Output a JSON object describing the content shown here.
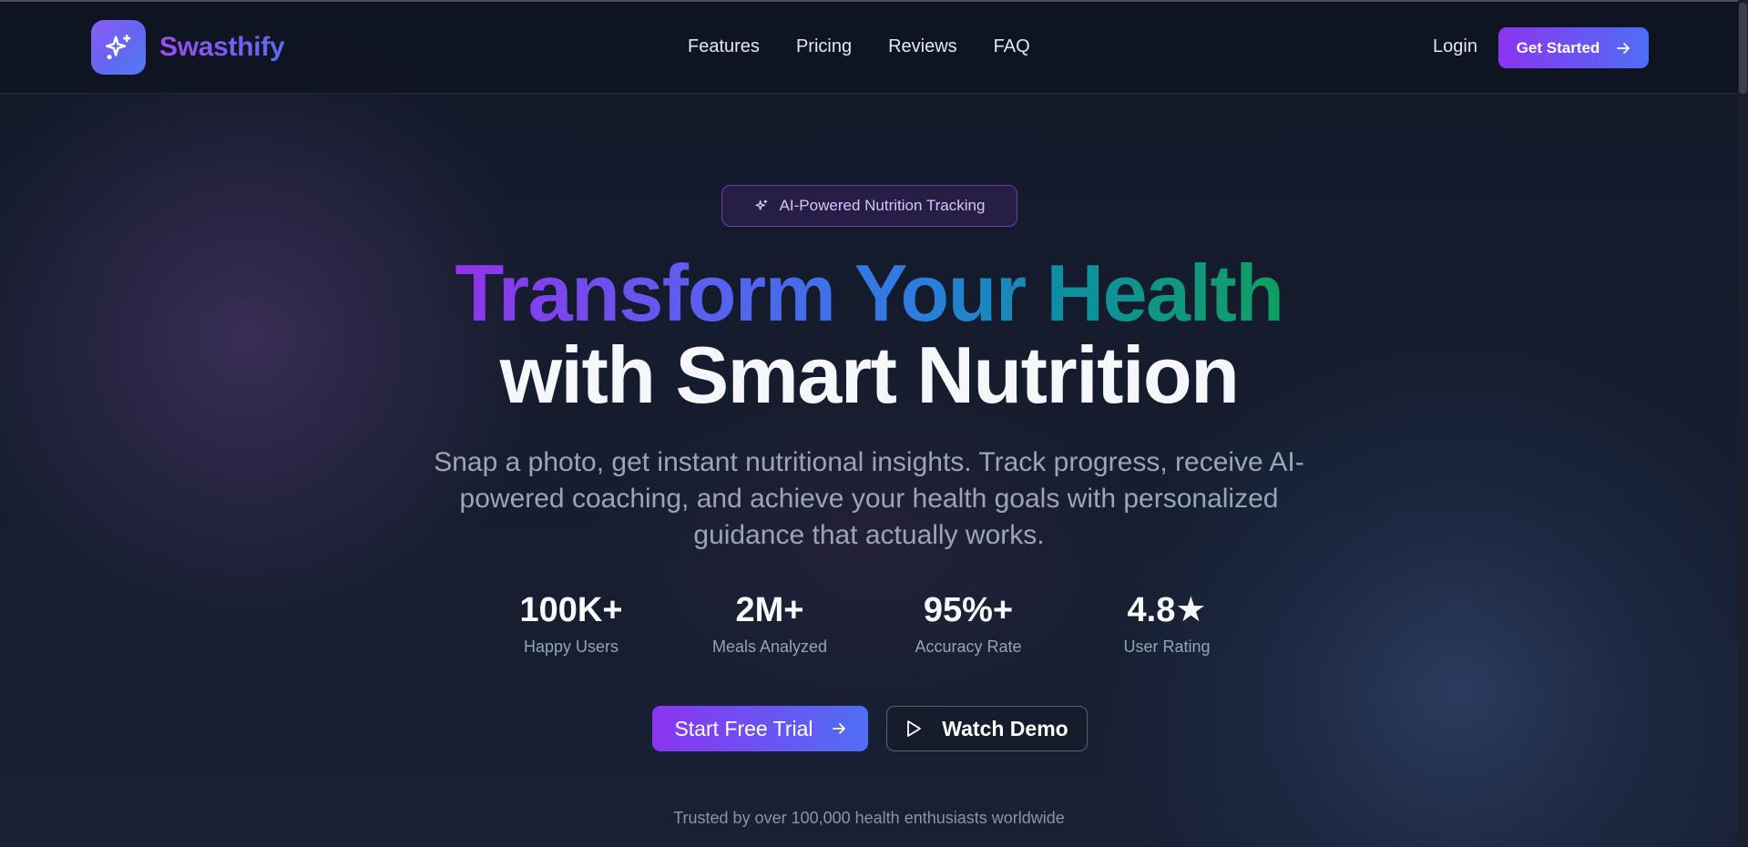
{
  "header": {
    "brand": "Swasthify",
    "nav": [
      "Features",
      "Pricing",
      "Reviews",
      "FAQ"
    ],
    "login": "Login",
    "cta": "Get Started"
  },
  "hero": {
    "badge": "AI-Powered Nutrition Tracking",
    "title_line1": "Transform Your Health",
    "title_line2": "with Smart Nutrition",
    "subtitle": "Snap a photo, get instant nutritional insights. Track progress, receive AI-powered coaching, and achieve your health goals with personalized guidance that actually works.",
    "stats": [
      {
        "value": "100K+",
        "label": "Happy Users"
      },
      {
        "value": "2M+",
        "label": "Meals Analyzed"
      },
      {
        "value": "95%+",
        "label": "Accuracy Rate"
      },
      {
        "value": "4.8★",
        "label": "User Rating"
      }
    ],
    "primary_cta": "Start Free Trial",
    "secondary_cta": "Watch Demo",
    "trusted": "Trusted by over 100,000 health enthusiasts worldwide"
  },
  "icons": {
    "logo": "sparkles-icon",
    "badge": "sparkles-icon",
    "cta_arrow": "arrow-right-icon",
    "demo": "play-icon"
  },
  "colors": {
    "background": "#141b2c",
    "accent_start": "#8b35f0",
    "accent_end": "#4f6ef5"
  }
}
